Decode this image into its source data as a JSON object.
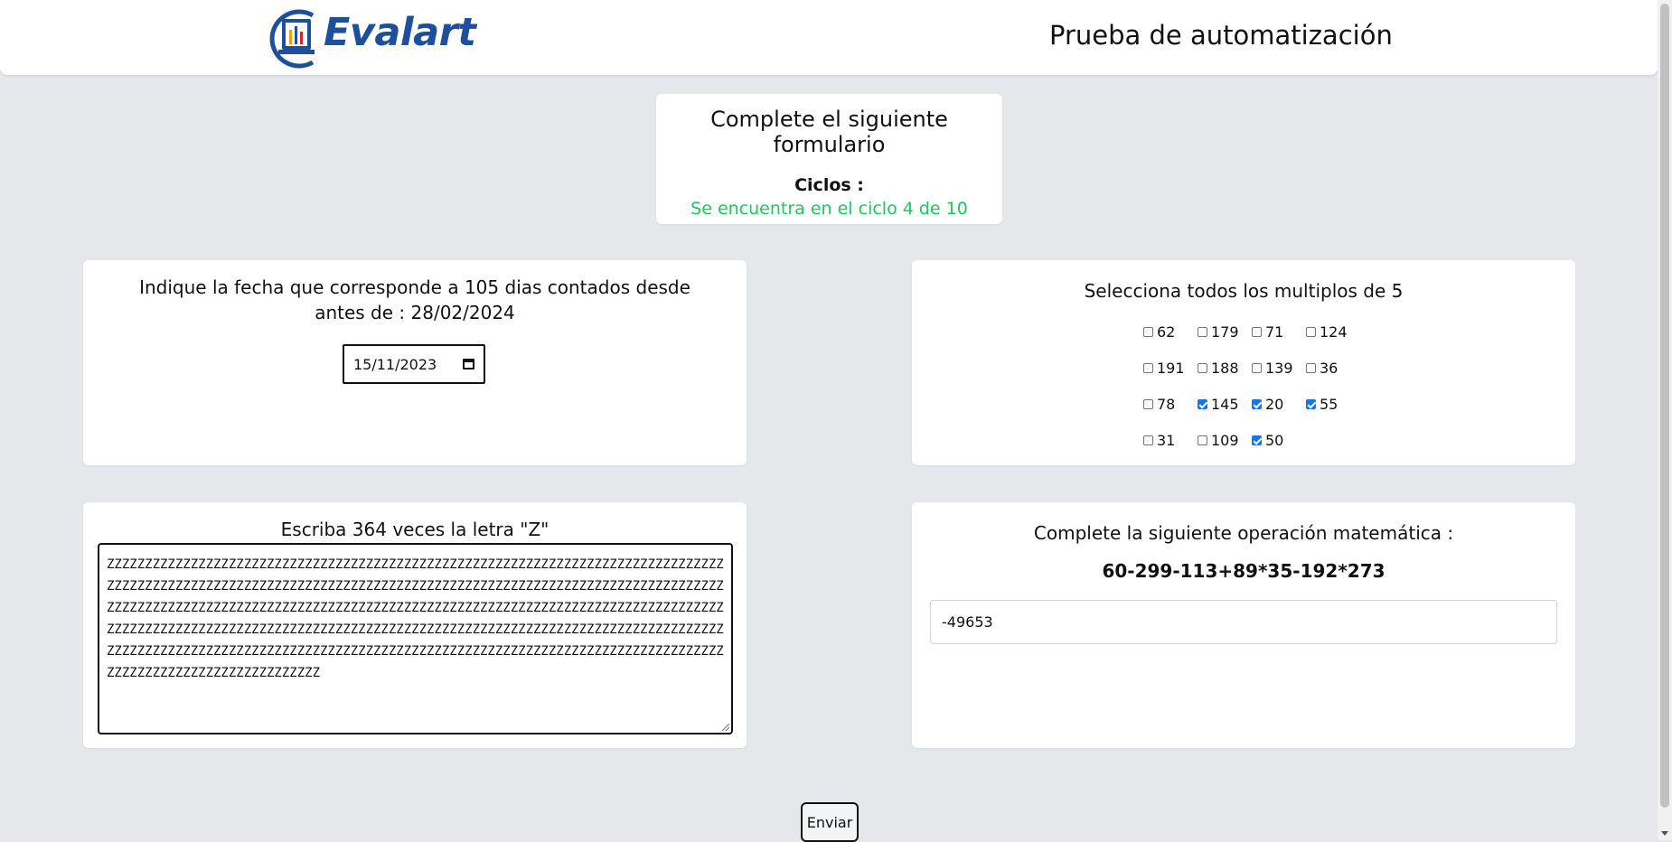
{
  "header": {
    "logo_text": "Evalart",
    "title": "Prueba de automatización"
  },
  "status": {
    "title": "Complete el siguiente formulario",
    "cycles_label": "Ciclos :",
    "cycles_status": "Se encuentra en el ciclo 4 de 10",
    "cycles_color": "#22c55e"
  },
  "date_question": {
    "prompt": "Indique la fecha que corresponde a 105 dias contados desde antes de : 28/02/2024",
    "value": "15/11/2023"
  },
  "multiples": {
    "prompt": "Selecciona todos los multiplos de 5",
    "options": [
      {
        "label": "62",
        "checked": false
      },
      {
        "label": "179",
        "checked": false
      },
      {
        "label": "71",
        "checked": false
      },
      {
        "label": "124",
        "checked": false
      },
      {
        "label": "191",
        "checked": false
      },
      {
        "label": "188",
        "checked": false
      },
      {
        "label": "139",
        "checked": false
      },
      {
        "label": "36",
        "checked": false
      },
      {
        "label": "78",
        "checked": false
      },
      {
        "label": "145",
        "checked": true
      },
      {
        "label": "20",
        "checked": true
      },
      {
        "label": "55",
        "checked": true
      },
      {
        "label": "31",
        "checked": false
      },
      {
        "label": "109",
        "checked": false
      },
      {
        "label": "50",
        "checked": true
      }
    ]
  },
  "text_question": {
    "prompt": "Escriba 364 veces la letra \"Z\"",
    "value": "ZZZZZZZZZZZZZZZZZZZZZZZZZZZZZZZZZZZZZZZZZZZZZZZZZZZZZZZZZZZZZZZZZZZZZZZZZZZZZZZZZZZZZZZZZZZZZZZZZZZZZZZZZZZZZZZZZZZZZZZZZZZZZZZZZZZZZZZZZZZZZZZZZZZZZZZZZZZZZZZZZZZZZZZZZZZZZZZZZZZZZZZZZZZZZZZZZZZZZZZZZZZZZZZZZZZZZZZZZZZZZZZZZZZZZZZZZZZZZZZZZZZZZZZZZZZZZZZZZZZZZZZZZZZZZZZZZZZZZZZZZZZZZZZZZZZZZZZZZZZZZZZZZZZZZZZZZZZZZZZZZZZZZZZZZZZZZZZZZZZZZZZZZZZZZZZZZZZZZZZZZZZZZZZZZZZZZZZZZZZZZZZZZZZZZZZZZZZZZZZZZZZZZZZZZZZZZZZZZZZZZZZZZZZZZZZZZ"
  },
  "math_question": {
    "prompt": "Complete la siguiente operación matemática :",
    "expression": "60-299-113+89*35-192*273",
    "value": "-49653"
  },
  "submit_label": "Enviar"
}
